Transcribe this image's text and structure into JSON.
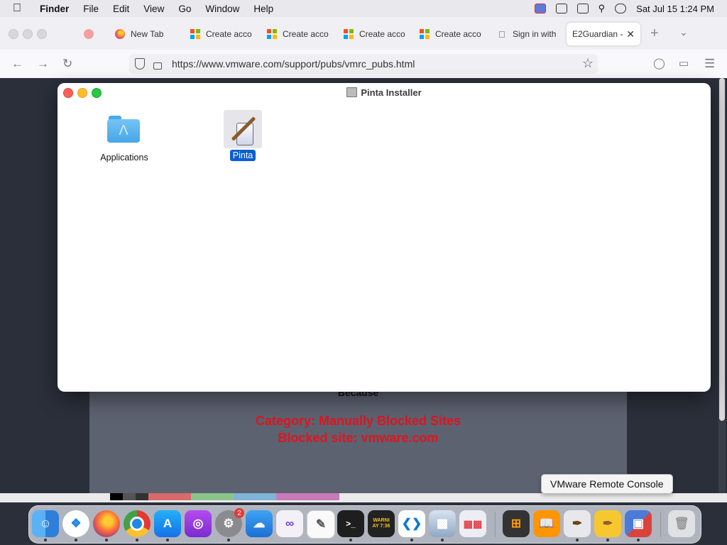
{
  "menubar": {
    "app_name": "Finder",
    "items": [
      "File",
      "Edit",
      "View",
      "Go",
      "Window",
      "Help"
    ],
    "clock": "Sat Jul 15  1:24 PM"
  },
  "browser": {
    "tabs": [
      {
        "label": "New Tab",
        "icon": "firefox-icon"
      },
      {
        "label": "Create acco",
        "icon": "microsoft-icon"
      },
      {
        "label": "Create acco",
        "icon": "microsoft-icon"
      },
      {
        "label": "Create acco",
        "icon": "microsoft-icon"
      },
      {
        "label": "Create acco",
        "icon": "microsoft-icon"
      },
      {
        "label": "Sign in with",
        "icon": "apple-icon"
      },
      {
        "label": "E2Guardian -",
        "icon": "none"
      }
    ],
    "url": "https://www.vmware.com/support/pubs/vmrc_pubs.html"
  },
  "blocked_page": {
    "because": "Because",
    "category": "Category: Manually Blocked Sites",
    "site": "Blocked site: vmware.com"
  },
  "finder_window": {
    "title": "Pinta Installer",
    "items": [
      {
        "label": "Applications",
        "icon": "applications-folder-icon"
      },
      {
        "label": "Pinta",
        "icon": "pinta-app-icon",
        "selected": true
      }
    ]
  },
  "tooltip": "VMware Remote Console",
  "dock": {
    "apps": [
      "Finder",
      "Safari",
      "Firefox",
      "Chrome",
      "App Store",
      "Podcasts",
      "System Settings",
      "Weather",
      "Visual Studio",
      "TextEdit",
      "Terminal",
      "Console",
      "VS Code",
      "Preview",
      "Launchpad",
      "Calculator",
      "Books",
      "Pinta",
      "Pinta Installer",
      "VMware Remote Console",
      "Trash"
    ],
    "settings_badge": "2",
    "console_text": "WARNI\nAY 7:36"
  }
}
